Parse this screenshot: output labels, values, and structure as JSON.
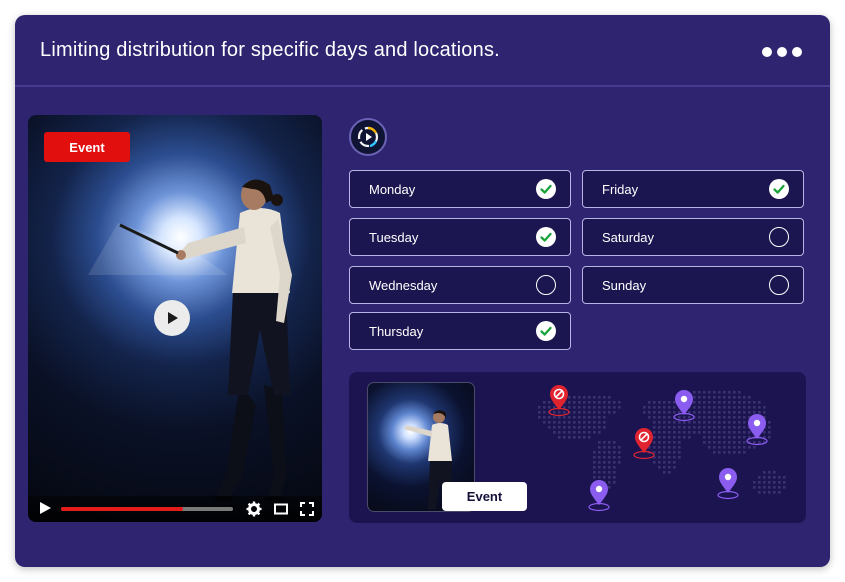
{
  "header": {
    "title": "Limiting distribution for specific days and locations."
  },
  "video": {
    "badge": "Event",
    "progress": 0.71
  },
  "days": [
    {
      "label": "Monday",
      "checked": true
    },
    {
      "label": "Tuesday",
      "checked": true
    },
    {
      "label": "Wednesday",
      "checked": false
    },
    {
      "label": "Thursday",
      "checked": true
    },
    {
      "label": "Friday",
      "checked": true
    },
    {
      "label": "Saturday",
      "checked": false
    },
    {
      "label": "Sunday",
      "checked": false
    }
  ],
  "locations": {
    "thumbnail_label": "Event",
    "pins": [
      {
        "status": "blocked"
      },
      {
        "status": "allowed"
      },
      {
        "status": "blocked"
      },
      {
        "status": "allowed"
      },
      {
        "status": "allowed"
      },
      {
        "status": "allowed"
      }
    ]
  },
  "colors": {
    "background": "#2e2470",
    "badge_red": "#e20f0f",
    "check_green": "#1aa33a",
    "pin_blocked": "#e0242f",
    "pin_allowed": "#8a5cf0"
  },
  "icons": [
    "more-dots-icon",
    "play-icon",
    "settings-gear-icon",
    "theater-mode-icon",
    "fullscreen-icon",
    "app-logo-icon",
    "check-icon",
    "location-pin-icon",
    "blocked-icon"
  ]
}
